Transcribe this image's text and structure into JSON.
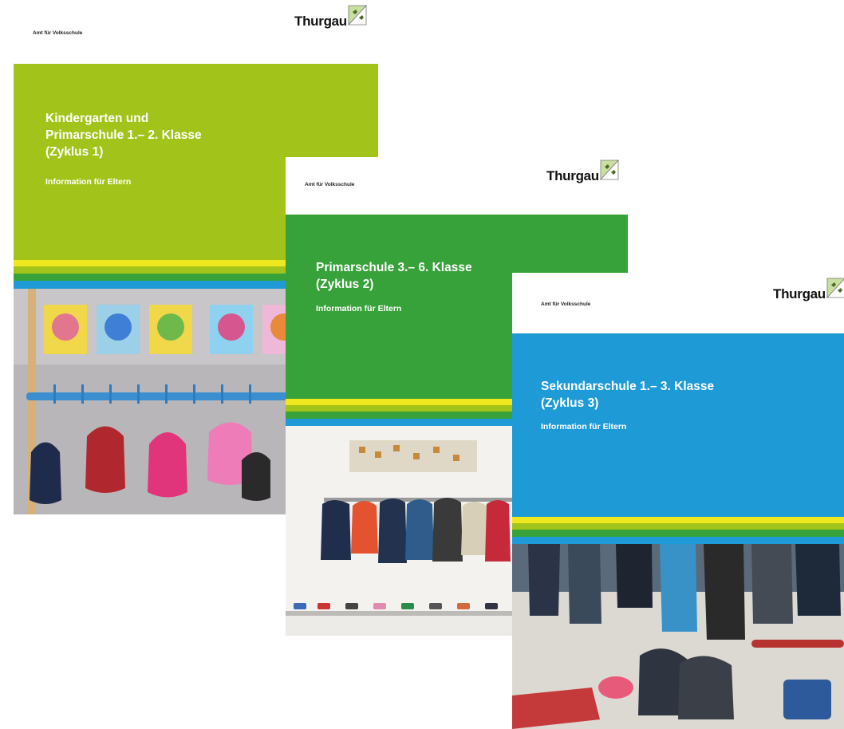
{
  "brochures": [
    {
      "department": "Amt für Volksschule",
      "logo": "Thurgau",
      "title": "Kindergarten und\nPrimarschule 1.– 2. Klasse\n(Zyklus 1)",
      "subtitle": "Information für Eltern",
      "color": "#a2c41a"
    },
    {
      "department": "Amt für Volksschule",
      "logo": "Thurgau",
      "title": "Primarschule 3.– 6. Klasse\n(Zyklus 2)",
      "subtitle": "Information für Eltern",
      "color": "#37a239"
    },
    {
      "department": "Amt für Volksschule",
      "logo": "Thurgau",
      "title": "Sekundarschule 1.– 3. Klasse\n(Zyklus 3)",
      "subtitle": "Information für Eltern",
      "color": "#1e9ad6"
    }
  ],
  "stripe_colors": [
    "#f0e81e",
    "#a2c41a",
    "#37a239",
    "#1e9ad6"
  ]
}
